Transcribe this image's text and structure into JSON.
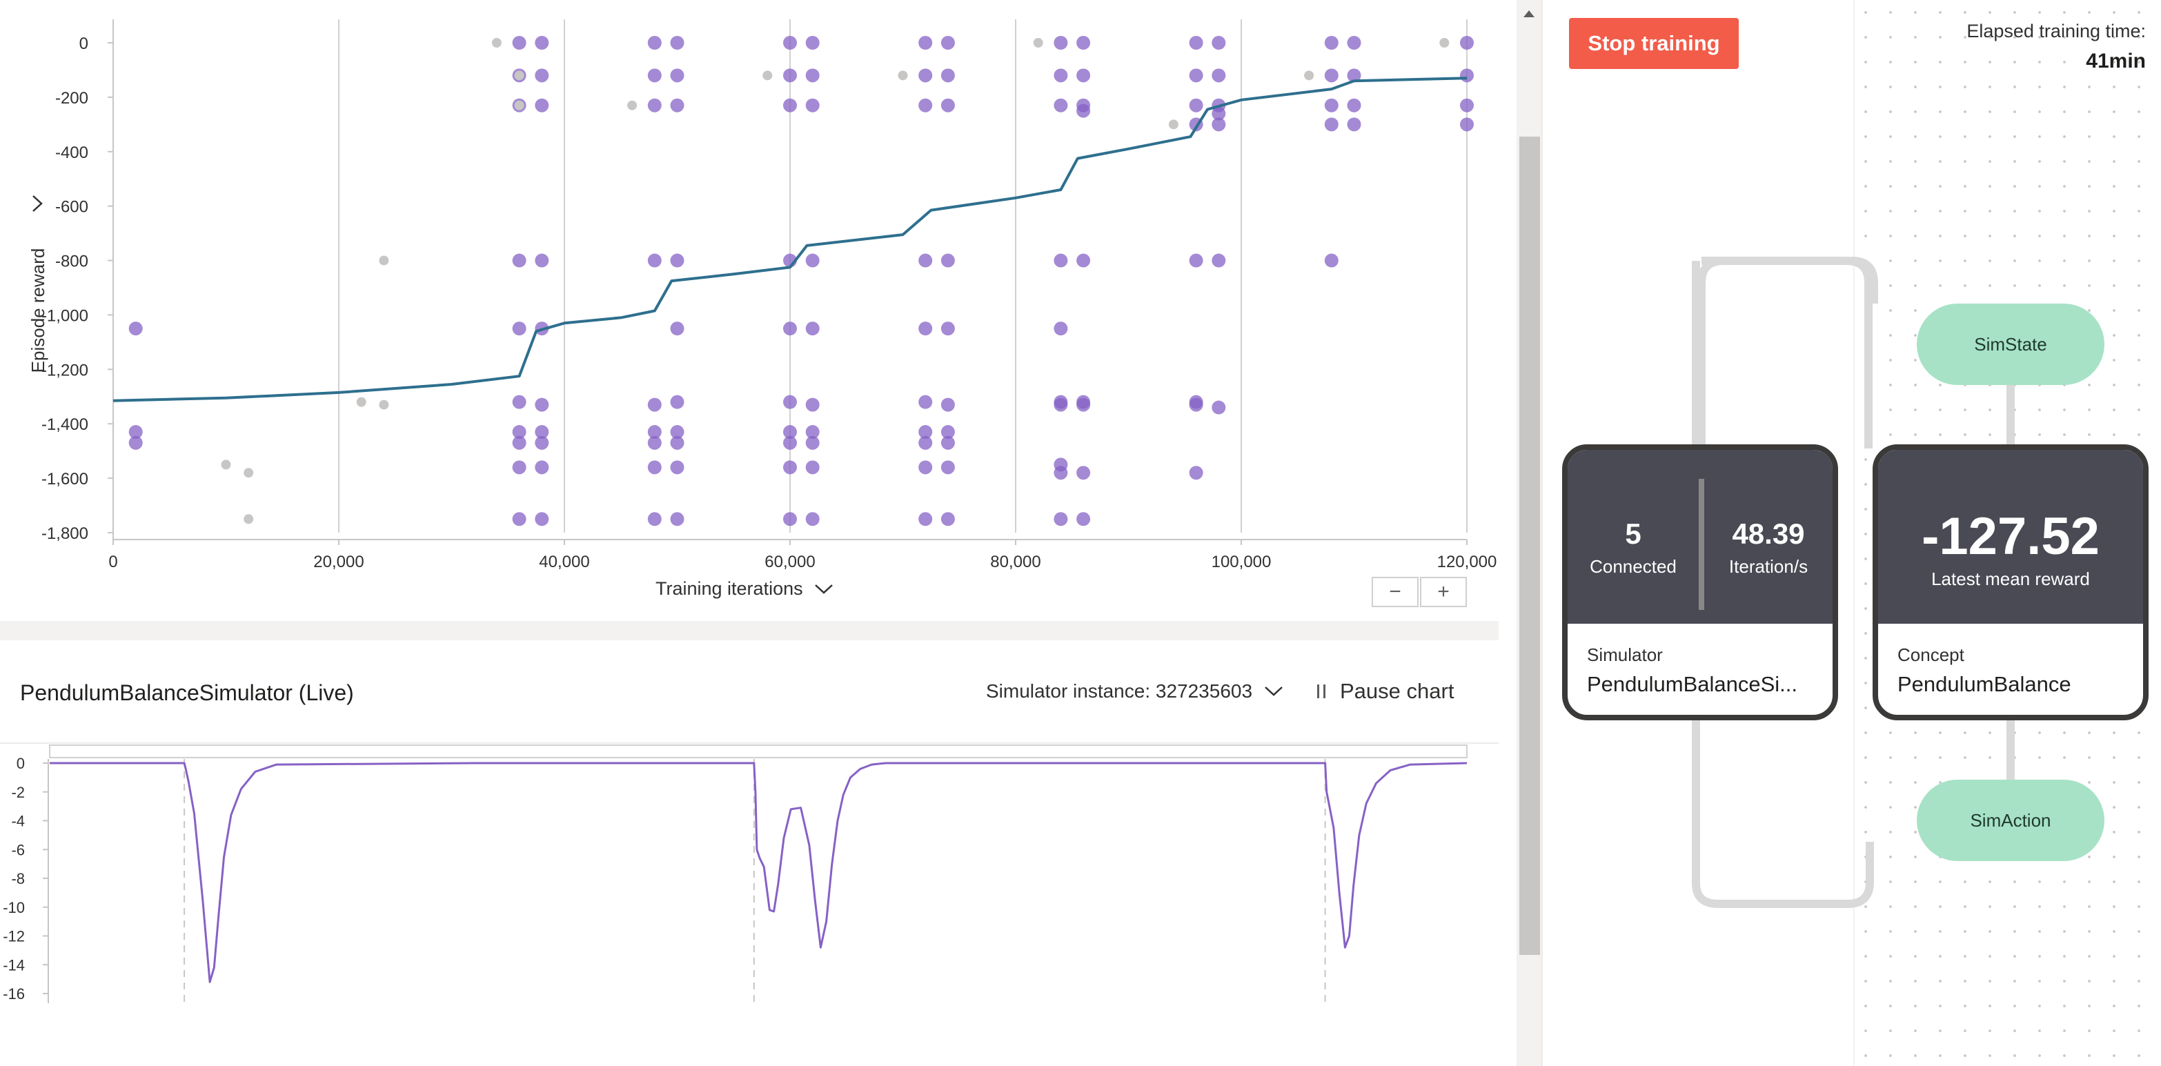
{
  "reward_chart": {
    "ylabel": "Episode reward",
    "xlabel": "Training iterations",
    "zoom_out": "−",
    "zoom_in": "+",
    "chart_data": {
      "type": "scatter",
      "xlim": [
        0,
        120000
      ],
      "ylim": [
        -1800,
        0
      ],
      "x_ticks": [
        0,
        20000,
        40000,
        60000,
        80000,
        100000,
        120000
      ],
      "x_tick_labels": [
        "0",
        "20,000",
        "40,000",
        "60,000",
        "80,000",
        "100,000",
        "120,000"
      ],
      "y_ticks": [
        0,
        -200,
        -400,
        -600,
        -800,
        -1000,
        -1200,
        -1400,
        -1600,
        -1800
      ],
      "y_tick_labels": [
        "0",
        "-200",
        "-400",
        "-600",
        "-800",
        "-1,000",
        "-1,200",
        "-1,400",
        "-1,600",
        "-1,800"
      ],
      "vertical_gridlines": [
        20000,
        40000,
        60000,
        80000,
        100000,
        120000
      ],
      "series": [
        {
          "kind": "points",
          "color": "#8661c5",
          "x": [
            2000,
            2000,
            2000,
            36000,
            36000,
            36000,
            36000,
            36000,
            36000,
            36000,
            36000,
            36000,
            36000,
            38000,
            38000,
            38000,
            38000,
            38000,
            38000,
            38000,
            38000,
            38000,
            38000,
            48000,
            48000,
            48000,
            48000,
            48000,
            48000,
            48000,
            48000,
            48000,
            50000,
            50000,
            50000,
            50000,
            50000,
            50000,
            50000,
            50000,
            50000,
            50000,
            60000,
            60000,
            60000,
            60000,
            60000,
            60000,
            60000,
            60000,
            60000,
            60000,
            62000,
            62000,
            62000,
            62000,
            62000,
            62000,
            62000,
            62000,
            62000,
            62000,
            72000,
            72000,
            72000,
            72000,
            72000,
            72000,
            72000,
            72000,
            72000,
            72000,
            74000,
            74000,
            74000,
            74000,
            74000,
            74000,
            74000,
            74000,
            74000,
            74000,
            84000,
            84000,
            84000,
            84000,
            84000,
            84000,
            84000,
            84000,
            84000,
            84000,
            86000,
            86000,
            86000,
            86000,
            86000,
            86000,
            86000,
            86000,
            86000,
            96000,
            96000,
            96000,
            96000,
            96000,
            96000,
            96000,
            96000,
            98000,
            98000,
            98000,
            98000,
            98000,
            98000,
            98000,
            108000,
            108000,
            108000,
            108000,
            108000,
            110000,
            110000,
            110000,
            110000,
            120000,
            120000,
            120000,
            120000
          ],
          "y": [
            -1050,
            -1430,
            -1470,
            0,
            -120,
            -230,
            -800,
            -1050,
            -1320,
            -1430,
            -1470,
            -1560,
            -1750,
            0,
            -120,
            -230,
            -800,
            -1050,
            -1330,
            -1430,
            -1470,
            -1560,
            -1750,
            0,
            -120,
            -230,
            -800,
            -1330,
            -1430,
            -1470,
            -1560,
            -1750,
            0,
            -120,
            -230,
            -800,
            -1050,
            -1320,
            -1430,
            -1470,
            -1560,
            -1750,
            0,
            -120,
            -230,
            -800,
            -1050,
            -1320,
            -1430,
            -1470,
            -1560,
            -1750,
            0,
            -120,
            -230,
            -800,
            -1050,
            -1330,
            -1430,
            -1470,
            -1560,
            -1750,
            0,
            -120,
            -230,
            -800,
            -1050,
            -1320,
            -1430,
            -1470,
            -1560,
            -1750,
            0,
            -120,
            -230,
            -800,
            -1050,
            -1330,
            -1430,
            -1470,
            -1560,
            -1750,
            0,
            -120,
            -230,
            -800,
            -1050,
            -1320,
            -1330,
            -1550,
            -1580,
            -1750,
            0,
            -120,
            -230,
            -800,
            -1330,
            -1320,
            -1580,
            -1750,
            -250,
            0,
            -120,
            -230,
            -300,
            -800,
            -1320,
            -1330,
            -1580,
            0,
            -120,
            -230,
            -300,
            -800,
            -1340,
            -260,
            0,
            -120,
            -230,
            -300,
            -800,
            0,
            -120,
            -230,
            -300,
            0,
            -120,
            -230,
            -300
          ]
        },
        {
          "kind": "points-faded",
          "color": "#c8c6c4",
          "x": [
            10000,
            12000,
            12000,
            22000,
            24000,
            24000,
            34000,
            36000,
            36000,
            46000,
            58000,
            70000,
            82000,
            94000,
            106000,
            118000
          ],
          "y": [
            -1550,
            -1580,
            -1750,
            -1320,
            -1330,
            -800,
            0,
            -120,
            -230,
            -230,
            -120,
            -120,
            0,
            -300,
            -120,
            0
          ]
        },
        {
          "kind": "line",
          "name": "",
          "color": "#2e6f8e",
          "x": [
            0,
            10000,
            20000,
            30000,
            36000,
            37500,
            40000,
            45000,
            48000,
            49500,
            55000,
            60000,
            61500,
            70000,
            72500,
            80000,
            84000,
            85500,
            90000,
            95500,
            97000,
            100000,
            108000,
            110000,
            120000
          ],
          "y": [
            -1315,
            -1305,
            -1285,
            -1255,
            -1225,
            -1060,
            -1030,
            -1010,
            -985,
            -875,
            -850,
            -825,
            -745,
            -705,
            -615,
            -570,
            -540,
            -425,
            -390,
            -345,
            -245,
            -210,
            -170,
            -140,
            -130
          ]
        }
      ]
    }
  },
  "simulator": {
    "title": "PendulumBalanceSimulator (Live)",
    "instance_label": "Simulator instance: 327235603",
    "pause_label": "Pause chart",
    "chart_data": {
      "type": "line",
      "xlim": [
        0,
        1000
      ],
      "ylim": [
        -16,
        0
      ],
      "y_ticks": [
        0,
        -2,
        -4,
        -6,
        -8,
        -10,
        -12,
        -14,
        -16
      ],
      "y_tick_labels": [
        "0",
        "-2",
        "-4",
        "-6",
        "-8",
        "-10",
        "-12",
        "-14",
        "-16"
      ],
      "episode_boundaries": [
        95,
        497,
        900
      ],
      "series": [
        {
          "color": "#8661c5",
          "x": [
            0,
            95,
            96,
            98,
            102,
            108,
            113,
            116,
            119,
            123,
            128,
            135,
            145,
            160,
            300,
            497,
            498,
            499,
            501,
            504,
            508,
            511,
            514,
            518,
            523,
            530,
            536,
            540,
            544,
            548,
            552,
            556,
            560,
            565,
            572,
            580,
            590,
            610,
            800,
            900,
            901,
            903,
            906,
            910,
            914,
            917,
            920,
            924,
            929,
            936,
            946,
            960,
            1000
          ],
          "y": [
            0,
            0,
            -0.4,
            -1.3,
            -3.5,
            -9.5,
            -15.2,
            -14.2,
            -10.8,
            -6.5,
            -3.6,
            -1.8,
            -0.6,
            -0.1,
            0,
            0,
            -2.0,
            -6.0,
            -6.6,
            -7.2,
            -10.2,
            -10.3,
            -8.4,
            -5.2,
            -3.2,
            -3.1,
            -5.7,
            -9.5,
            -12.8,
            -11.0,
            -7.0,
            -4.0,
            -2.2,
            -1.0,
            -0.4,
            -0.1,
            0,
            0,
            0,
            0,
            -2.0,
            -3.0,
            -4.5,
            -9.0,
            -12.8,
            -12.0,
            -8.5,
            -5.0,
            -2.8,
            -1.4,
            -0.5,
            -0.1,
            0
          ]
        }
      ]
    }
  },
  "controls": {
    "stop_label": "Stop training",
    "elapsed_label": "Elapsed training time:",
    "elapsed_value": "41min"
  },
  "graph": {
    "simulator_node": {
      "connected_value": "5",
      "connected_label": "Connected",
      "iter_value": "48.39",
      "iter_label": "Iteration/s",
      "type_label": "Simulator",
      "name": "PendulumBalanceSi..."
    },
    "concept_node": {
      "reward_value": "-127.52",
      "reward_label": "Latest mean reward",
      "type_label": "Concept",
      "name": "PendulumBalance"
    },
    "simstate_label": "SimState",
    "simaction_label": "SimAction",
    "colors": {
      "node_header": "#4a4a55",
      "node_border": "#3b3a39",
      "pill": "#a7e2c6",
      "connector": "#d9d9d9",
      "stop_button": "#f25c49"
    }
  }
}
